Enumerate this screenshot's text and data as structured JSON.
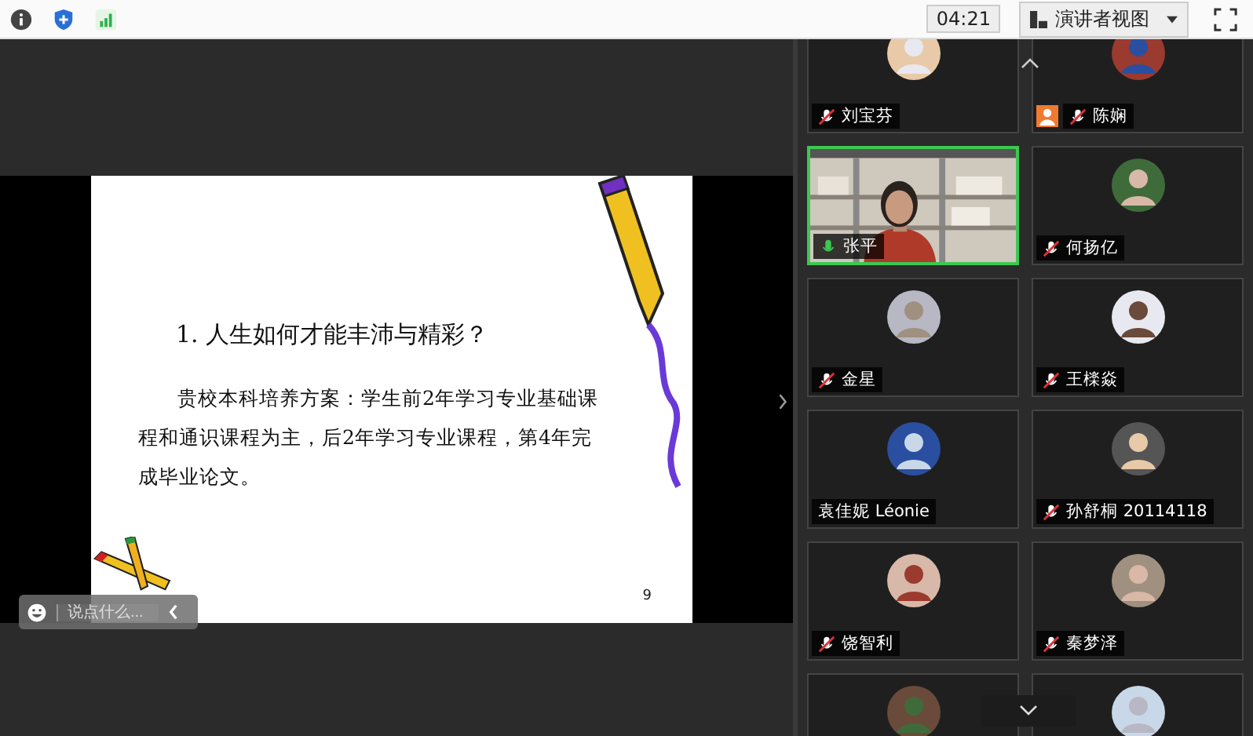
{
  "top_bar": {
    "timer": "04:21",
    "view_button": "演讲者视图"
  },
  "slide": {
    "question": "1.  人生如何才能丰沛与精彩？",
    "body": "贵校本科培养方案：学生前2年学习专业基础课程和通识课程为主，后2年学习专业课程，第4年完成毕业论文。",
    "page": "9"
  },
  "chat": {
    "placeholder": "说点什么..."
  },
  "participants": [
    {
      "name": "刘宝芬",
      "muted": true,
      "speaking": false,
      "kind": "avatar",
      "highlighted": false,
      "host_badge": false
    },
    {
      "name": "陈娴",
      "muted": true,
      "speaking": false,
      "kind": "avatar",
      "highlighted": false,
      "host_badge": true
    },
    {
      "name": "张平",
      "muted": false,
      "speaking": true,
      "kind": "video",
      "highlighted": true,
      "host_badge": false
    },
    {
      "name": "何扬亿",
      "muted": true,
      "speaking": false,
      "kind": "avatar",
      "highlighted": false,
      "host_badge": false
    },
    {
      "name": "金星",
      "muted": true,
      "speaking": false,
      "kind": "avatar",
      "highlighted": false,
      "host_badge": false
    },
    {
      "name": "王檪焱",
      "muted": true,
      "speaking": false,
      "kind": "avatar",
      "highlighted": false,
      "host_badge": false
    },
    {
      "name": "袁佳妮 Léonie",
      "muted": false,
      "speaking": false,
      "kind": "avatar",
      "highlighted": false,
      "host_badge": false
    },
    {
      "name": "孙舒桐 20114118",
      "muted": true,
      "speaking": false,
      "kind": "avatar",
      "highlighted": false,
      "host_badge": false
    },
    {
      "name": "饶智利",
      "muted": true,
      "speaking": false,
      "kind": "avatar",
      "highlighted": false,
      "host_badge": false
    },
    {
      "name": "秦梦泽",
      "muted": true,
      "speaking": false,
      "kind": "avatar",
      "highlighted": false,
      "host_badge": false
    },
    {
      "kind": "avatar",
      "highlighted": false
    },
    {
      "kind": "avatar",
      "highlighted": false
    }
  ]
}
